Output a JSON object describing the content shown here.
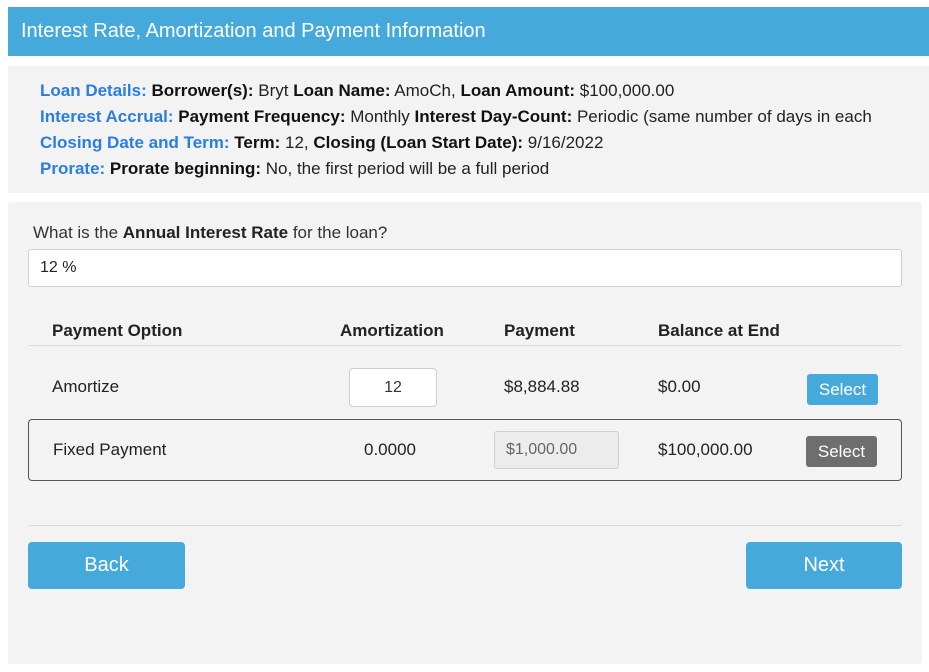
{
  "header": {
    "title": "Interest Rate, Amortization and Payment Information"
  },
  "summary": {
    "loan_details": {
      "category": "Loan Details:",
      "borrower_label": "Borrower(s):",
      "borrower_value": "Bryt",
      "loan_name_label": "Loan Name:",
      "loan_name_value": "AmoCh,",
      "loan_amount_label": "Loan Amount:",
      "loan_amount_value": "$100,000.00"
    },
    "interest_accrual": {
      "category": "Interest Accrual:",
      "frequency_label": "Payment Frequency:",
      "frequency_value": "Monthly",
      "daycount_label": "Interest Day-Count:",
      "daycount_value": "Periodic (same number of days in each"
    },
    "closing": {
      "category": "Closing Date and Term:",
      "term_label": "Term:",
      "term_value": "12,",
      "closing_label": "Closing (Loan Start Date):",
      "closing_value": "9/16/2022"
    },
    "prorate": {
      "category": "Prorate:",
      "prorate_label": "Prorate beginning:",
      "prorate_value": "No, the first period will be a full period"
    }
  },
  "form": {
    "question_prefix": "What is the",
    "question_bold": "Annual Interest Rate",
    "question_suffix": "for the loan?",
    "rate_value": "12 %"
  },
  "table": {
    "headers": {
      "option": "Payment Option",
      "amortization": "Amortization",
      "payment": "Payment",
      "balance": "Balance at End"
    },
    "rows": [
      {
        "option": "Amortize",
        "amortization": "12",
        "payment": "$8,884.88",
        "balance": "$0.00",
        "button": "Select"
      },
      {
        "option": "Fixed Payment",
        "amortization": "0.0000",
        "payment": "$1,000.00",
        "balance": "$100,000.00",
        "button": "Select"
      }
    ]
  },
  "nav": {
    "back_label": "Back",
    "next_label": "Next"
  },
  "colors": {
    "accent": "#46a9dc",
    "category_text": "#2a7de1",
    "selected_button": "#6e6e6e"
  }
}
